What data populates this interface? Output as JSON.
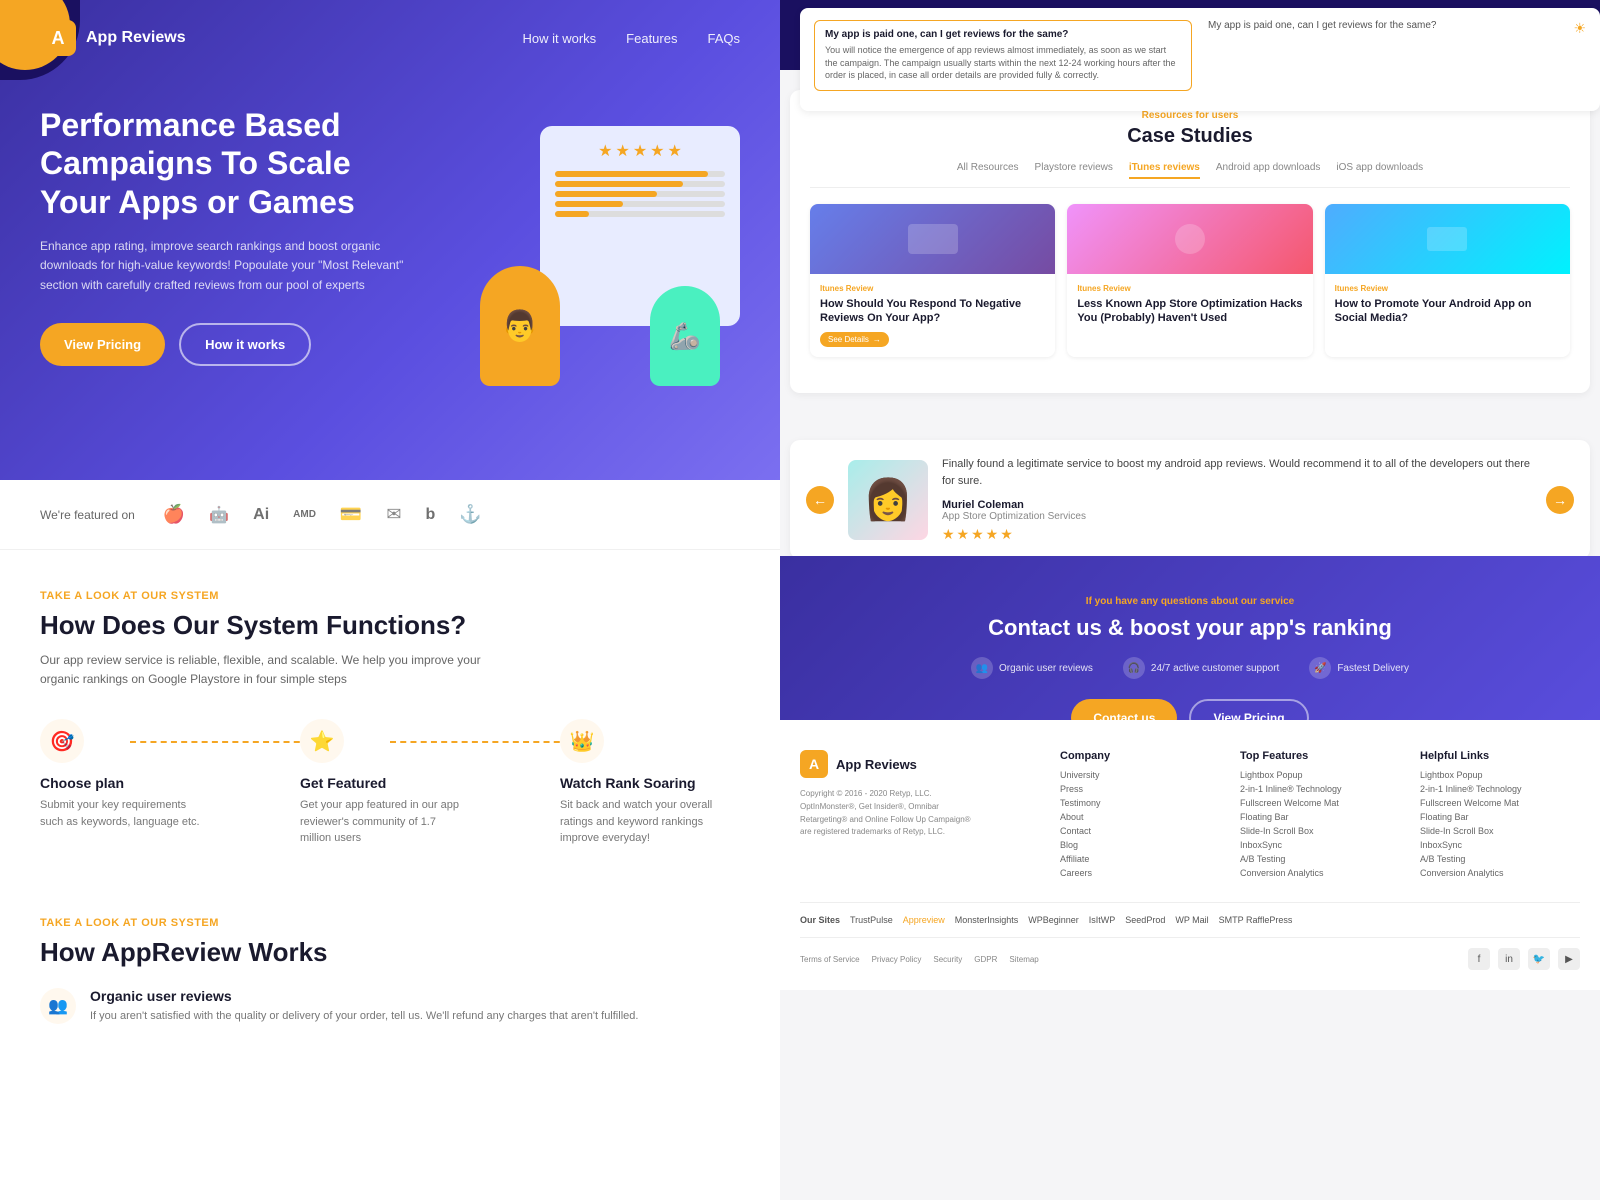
{
  "brand": {
    "logo_letter": "A",
    "name": "App Reviews"
  },
  "navbar": {
    "links": [
      "How it works",
      "Features",
      "FAQs"
    ]
  },
  "hero": {
    "title": "Performance Based Campaigns To Scale Your Apps or Games",
    "description": "Enhance app rating, improve search rankings and boost organic downloads for high-value keywords! Popoulate your \"Most Relevant\" section with carefully crafted reviews from our pool of experts",
    "btn_primary": "View Pricing",
    "btn_secondary": "How it works"
  },
  "featured": {
    "label": "We're featured on",
    "icons": [
      "🍎",
      "🅰",
      "🅰",
      "AMD",
      "P",
      "✉",
      "▶",
      "⚓"
    ]
  },
  "system_section": {
    "tag": "Take a look at our system",
    "title": "How Does Our System Functions?",
    "description": "Our app review service is reliable, flexible, and scalable. We help you improve your organic rankings on Google Playstore in four simple steps",
    "steps": [
      {
        "icon": "🎯",
        "title": "Choose plan",
        "desc": "Submit your key requirements such as keywords, language etc."
      },
      {
        "icon": "⭐",
        "title": "Get Featured",
        "desc": "Get your app featured in our app reviewer's community of 1.7 million users"
      },
      {
        "icon": "👑",
        "title": "Watch Rank Soaring",
        "desc": "Sit back and watch your overall ratings and keyword rankings improve everyday!"
      }
    ]
  },
  "appreview_section": {
    "tag": "Take a look at our system",
    "title": "How AppReview Works",
    "organic": {
      "icon": "👥",
      "title": "Organic user reviews",
      "desc": "If you aren't satisfied with the quality or delivery of your order, tell us. We'll refund any charges that aren't fulfilled."
    }
  },
  "faq": {
    "question": "My app is paid one, can I get reviews for the same?",
    "answer": "You will notice the emergence of app reviews almost immediately, as soon as we start the campaign. The campaign usually starts within the next 12-24 working hours after the order is placed, in case all order details are provided fully & correctly.",
    "sun_icon": "☀"
  },
  "case_studies": {
    "tag": "Resources for users",
    "title": "Case Studies",
    "tabs": [
      "All Resources",
      "Playstore reviews",
      "iTunes reviews",
      "Android app downloads",
      "iOS app downloads"
    ],
    "active_tab": 2,
    "cards": [
      {
        "tag": "Itunes Review",
        "title": "How Should You Respond To Negative Reviews On Your App?",
        "link_label": "See Details"
      },
      {
        "tag": "Itunes Review",
        "title": "Less Known App Store Optimization Hacks You (Probably) Haven't Used",
        "link_label": ""
      },
      {
        "tag": "Itunes Review",
        "title": "How to Promote Your Android App on Social Media?",
        "link_label": ""
      }
    ]
  },
  "testimonial": {
    "text": "Finally found a legitimate service to boost my android app reviews. Would recommend it to all of the developers out there for sure.",
    "author": "Muriel Coleman",
    "role": "App Store Optimization Services",
    "stars": "★★★★★",
    "prev_icon": "←",
    "next_icon": "→"
  },
  "cta": {
    "tag": "If you have any questions about our service",
    "title": "Contact us & boost your app's ranking",
    "features": [
      {
        "icon": "👥",
        "label": "Organic user reviews"
      },
      {
        "icon": "🎧",
        "label": "24/7 active customer support"
      },
      {
        "icon": "🚀",
        "label": "Fastest Delivery"
      }
    ],
    "btn_contact": "Contact us",
    "btn_pricing": "View Pricing"
  },
  "footer": {
    "logo_letter": "A",
    "brand_name": "App Reviews",
    "copyright": "Copyright © 2016 - 2020 Retyp, LLC.\nOptInMonster®, Get Insider®, Omnibar Retargeting® and Online Follow Up Campaign® are registered trademarks of Retyp, LLC.",
    "columns": [
      {
        "title": "Company",
        "links": [
          "University",
          "Press",
          "Testimony",
          "About",
          "Contact",
          "Blog",
          "Affiliate",
          "Careers"
        ]
      },
      {
        "title": "Top Features",
        "links": [
          "Lightbox Popup",
          "2-in-1 Inline® Technology",
          "Fullscreen Welcome Mat",
          "Floating Bar",
          "Slide-In Scroll Box",
          "InboxSync",
          "A/B Testing",
          "Conversion Analytics"
        ]
      },
      {
        "title": "Helpful Links",
        "links": [
          "Lightbox Popup",
          "2-in-1 Inline® Technology",
          "Fullscreen Welcome Mat",
          "Floating Bar",
          "Slide-In Scroll Box",
          "InboxSync",
          "A/B Testing",
          "Conversion Analytics"
        ]
      }
    ],
    "our_sites_label": "Our Sites",
    "sites": [
      "TrustPulse",
      "Appreview",
      "MonsterInsights",
      "WPBeginner",
      "IsItWP",
      "SeedProd",
      "WP Mail",
      "SMTP RafflePress"
    ],
    "active_site": "Appreview",
    "legal_links": [
      "Terms of Service",
      "Privacy Policy",
      "Security",
      "GDPR",
      "Sitemap"
    ],
    "social_icons": [
      "f",
      "in",
      "🐦",
      "▶"
    ]
  }
}
